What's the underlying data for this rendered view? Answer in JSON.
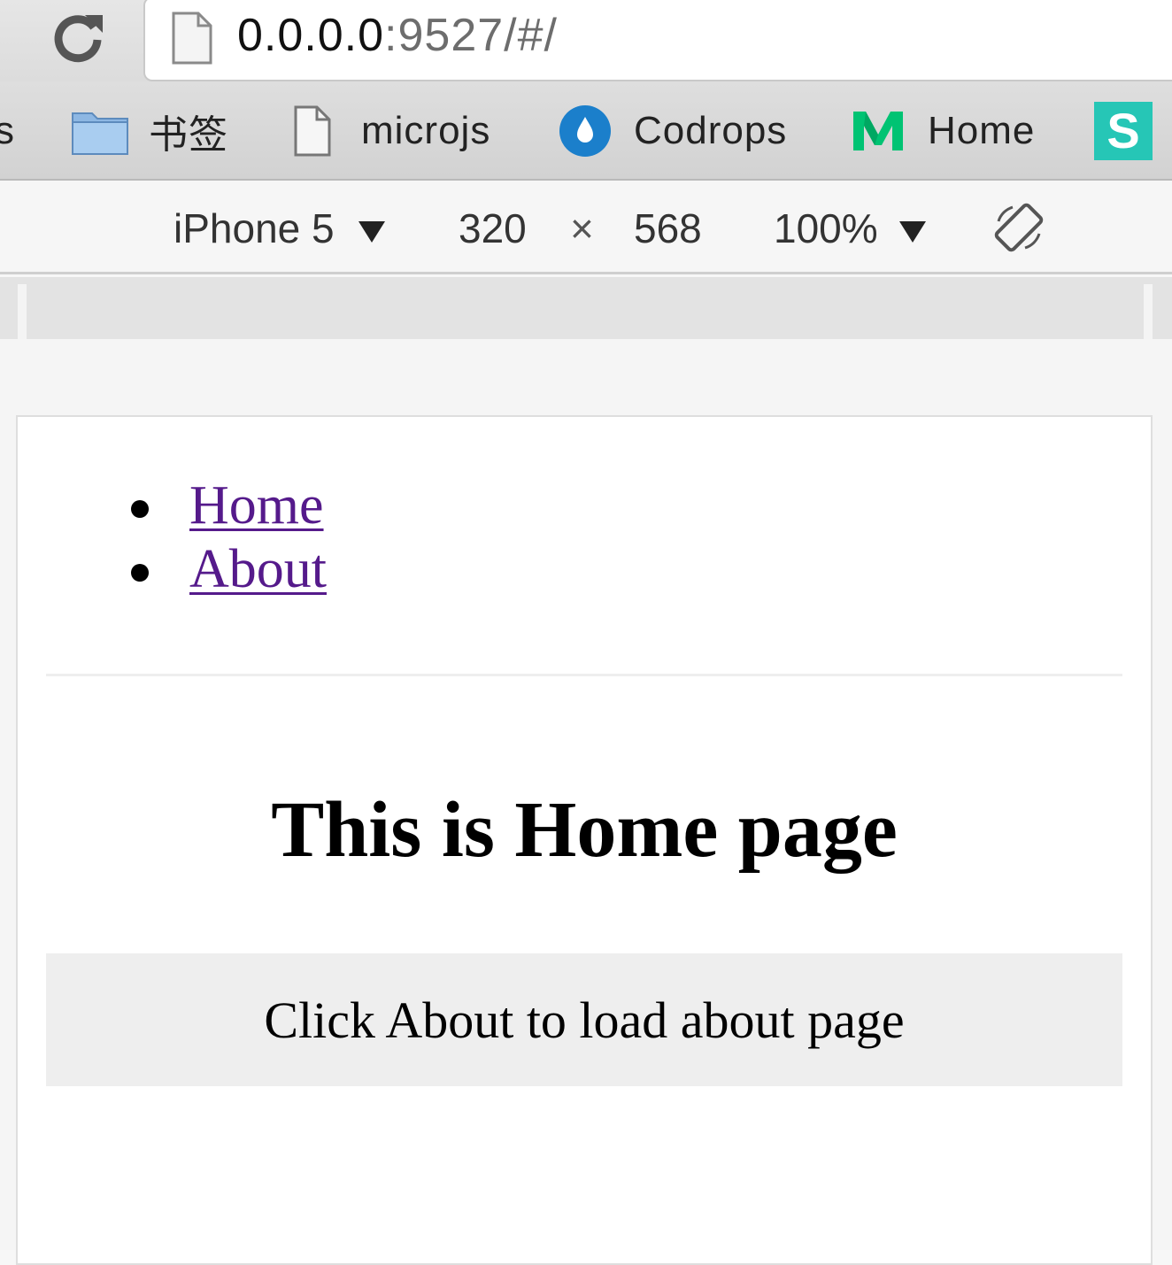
{
  "browser": {
    "url_host": "0.0.0.0",
    "url_rest": ":9527/#/",
    "icons": {
      "reload": "reload-icon",
      "page": "page-icon"
    }
  },
  "bookmarks": {
    "partial_label": "s",
    "items": [
      {
        "label": "书签",
        "icon": "folder-icon"
      },
      {
        "label": "microjs",
        "icon": "page-icon"
      },
      {
        "label": "Codrops",
        "icon": "codrops-icon"
      },
      {
        "label": "Home",
        "icon": "medium-icon"
      },
      {
        "label": "",
        "icon": "s-icon"
      }
    ]
  },
  "device_toolbar": {
    "device": "iPhone 5",
    "width": "320",
    "times": "×",
    "height": "568",
    "zoom": "100%",
    "icons": {
      "dropdown": "caret-down-icon",
      "rotate": "rotate-icon"
    }
  },
  "app": {
    "nav": [
      {
        "label": "Home"
      },
      {
        "label": "About"
      }
    ],
    "title": "This is Home page",
    "hint": "Click About to load about page"
  },
  "colors": {
    "link_visited": "#551a8b",
    "codrops_blue": "#1b7fcb",
    "medium_green": "#00c373",
    "s_teal": "#26c6b6"
  }
}
